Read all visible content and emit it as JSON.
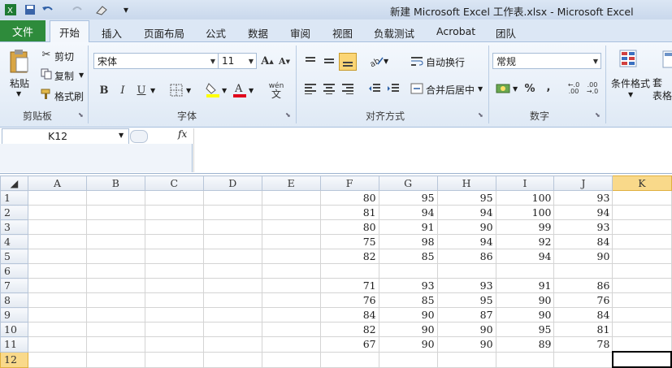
{
  "window": {
    "title": "新建 Microsoft Excel 工作表.xlsx - Microsoft Excel"
  },
  "ribbon": {
    "file_tab": "文件",
    "tabs": [
      "开始",
      "插入",
      "页面布局",
      "公式",
      "数据",
      "审阅",
      "视图",
      "负载测试",
      "Acrobat",
      "团队"
    ],
    "clipboard": {
      "paste": "粘贴",
      "cut": "剪切",
      "copy": "复制",
      "format_painter": "格式刷",
      "label": "剪贴板"
    },
    "font": {
      "name": "宋体",
      "size": "11",
      "label": "字体",
      "bold": "B",
      "italic": "I",
      "underline": "U"
    },
    "alignment": {
      "wrap": "自动换行",
      "merge": "合并后居中",
      "label": "对齐方式"
    },
    "number": {
      "format": "常规",
      "label": "数字",
      "percent": "%",
      "comma": ","
    },
    "styles": {
      "conditional": "条件格式",
      "table": "套\n表格"
    }
  },
  "formula_bar": {
    "name_box": "K12",
    "fx": "fx",
    "content": ""
  },
  "sheet": {
    "columns": [
      "A",
      "B",
      "C",
      "D",
      "E",
      "F",
      "G",
      "H",
      "I",
      "J",
      "K"
    ],
    "selected_column": "K",
    "selected_row": "12",
    "rows": [
      {
        "n": "1",
        "F": "80",
        "G": "95",
        "H": "95",
        "I": "100",
        "J": "93"
      },
      {
        "n": "2",
        "F": "81",
        "G": "94",
        "H": "94",
        "I": "100",
        "J": "94"
      },
      {
        "n": "3",
        "F": "80",
        "G": "91",
        "H": "90",
        "I": "99",
        "J": "93"
      },
      {
        "n": "4",
        "F": "75",
        "G": "98",
        "H": "94",
        "I": "92",
        "J": "84"
      },
      {
        "n": "5",
        "F": "82",
        "G": "85",
        "H": "86",
        "I": "94",
        "J": "90"
      },
      {
        "n": "6",
        "F": "",
        "G": "",
        "H": "",
        "I": "",
        "J": ""
      },
      {
        "n": "7",
        "F": "71",
        "G": "93",
        "H": "93",
        "I": "91",
        "J": "86"
      },
      {
        "n": "8",
        "F": "76",
        "G": "85",
        "H": "95",
        "I": "90",
        "J": "76"
      },
      {
        "n": "9",
        "F": "84",
        "G": "90",
        "H": "87",
        "I": "90",
        "J": "84"
      },
      {
        "n": "10",
        "F": "82",
        "G": "90",
        "H": "90",
        "I": "95",
        "J": "81"
      },
      {
        "n": "11",
        "F": "67",
        "G": "90",
        "H": "90",
        "I": "89",
        "J": "78"
      },
      {
        "n": "12",
        "F": "",
        "G": "",
        "H": "",
        "I": "",
        "J": ""
      }
    ]
  },
  "colors": {
    "file_tab": "#2e8b3b",
    "selected_header": "#f9d98a"
  }
}
